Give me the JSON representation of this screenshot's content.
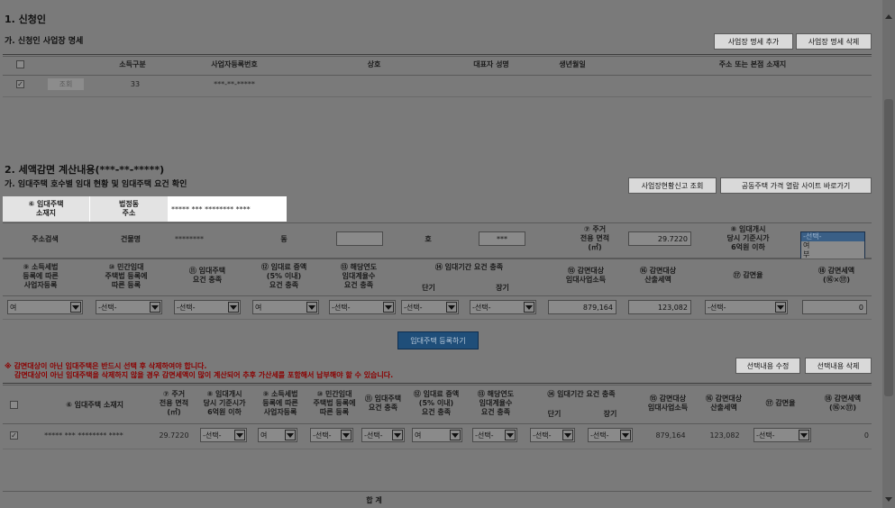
{
  "section1": {
    "title": "1. 신청인",
    "subtitle": "가. 신청인 사업장 명세",
    "add_btn": "사업장 명세 추가",
    "del_btn": "사업장 명세 삭제",
    "headers": [
      "소득구분",
      "사업자등록번호",
      "상호",
      "대표자 성명",
      "생년월일",
      "주소 또는 본점 소재지"
    ],
    "row": {
      "lookup_btn": "조회",
      "income_type": "33",
      "biz_no": "***-**-*****"
    }
  },
  "section2": {
    "title": "2. 세액감면 계산내용(***-**-*****)",
    "subtitle": "가. 임대주택 호수별 임대 현황 및 임대주택 요건 확인",
    "biz_status_btn": "사업장현황신고 조회",
    "price_site_btn": "공동주택 가격 열람 사이트 바로가기",
    "location": {
      "label1": "⑥ 임대주택",
      "label2": "소재지",
      "legal_dong_1": "법정동",
      "legal_dong_2": "주소",
      "value": "*****  ***  ********  ****"
    },
    "addr_row": {
      "search": "주소검색",
      "building": "건물명",
      "building_val": "********",
      "dong": "동",
      "ho": "호",
      "ho_val": "***",
      "area_l1": "⑦ 주거",
      "area_l2": "전용 면적",
      "area_l3": "(㎡)",
      "area_val": "29.7220",
      "price_l1": "⑧ 임대개시",
      "price_l2": "당시 기준시가",
      "price_l3": "6억원 이하",
      "dropdown_options": [
        "-선택-",
        "여",
        "부"
      ]
    },
    "req_headers": {
      "h1": [
        "⑨ 소득세법",
        "등록에 따른",
        "사업자등록"
      ],
      "h2": [
        "⑩ 민간임대",
        "주택법 등록에",
        "따른 등록"
      ],
      "h3": [
        "⑪ 임대주택",
        "요건 충족"
      ],
      "h4": [
        "⑫ 임대료 증액",
        "(5% 이내)",
        "요건 충족"
      ],
      "h5": [
        "⑬ 해당연도",
        "임대계율수",
        "요건 충족"
      ],
      "h6": "⑭ 임대기간 요건 충족",
      "h6a": "단기",
      "h6b": "장기",
      "h7": [
        "⑮ 감면대상",
        "임대사업소득"
      ],
      "h8": [
        "⑯ 감면대상",
        "산출세액"
      ],
      "h9": "⑰ 감면율",
      "h10": [
        "⑱ 감면세액",
        "(⑯×⑰)"
      ]
    },
    "req_values": {
      "v1": "여",
      "v2": "-선택-",
      "v3": "-선택-",
      "v4": "여",
      "v5": "-선택-",
      "v6a": "-선택-",
      "v6b": "-선택-",
      "income": "879,164",
      "tax": "123,082",
      "rate": "-선택-",
      "exempt": "0"
    },
    "register_btn": "임대주택 등록하기",
    "warn1": "※ 감면대상이 아닌 임대주택은 반드시 선택 후 삭제하여야 합니다.",
    "warn2": "감면대상이 아닌 임대주택을 삭제하지 않을 경우 감면세액이 많이 계산되어 추후 가산세를 포함해서 납부해야 할 수 있습니다.",
    "edit_btn": "선택내용 수정",
    "delete_btn": "선택내용 삭제"
  },
  "list": {
    "headers": {
      "loc": "⑥ 임대주택 소재지",
      "area": [
        "⑦ 주거",
        "전용 면적",
        "(㎡)"
      ],
      "price": [
        "⑧ 임대개시",
        "당시 기준시가",
        "6억원 이하"
      ],
      "h9": [
        "⑨ 소득세법",
        "등록에 따른",
        "사업자등록"
      ],
      "h10": [
        "⑩ 민간임대",
        "주택법 등록에",
        "따른 등록"
      ],
      "h11": [
        "⑪ 임대주택",
        "요건 충족"
      ],
      "h12": [
        "⑫ 임대료 증액",
        "(5% 이내)",
        "요건 충족"
      ],
      "h13": [
        "⑬ 해당연도",
        "임대계율수",
        "요건 충족"
      ],
      "h14": "⑭ 임대기간 요건 충족",
      "h14a": "단기",
      "h14b": "장기",
      "h15": [
        "⑮ 감면대상",
        "임대사업소득"
      ],
      "h16": [
        "⑯ 감면대상",
        "산출세액"
      ],
      "h17": "⑰ 감면율",
      "h18": [
        "⑱ 감면세액",
        "(⑯×⑰)"
      ]
    },
    "row": {
      "loc": "*****  ***  ********  ****",
      "area": "29.7220",
      "price": "-선택-",
      "h9": "여",
      "h10": "-선택-",
      "h11": "-선택-",
      "h12": "여",
      "h13": "-선택-",
      "h14a": "-선택-",
      "h14b": "-선택-",
      "income": "879,164",
      "tax": "123,082",
      "rate": "-선택-",
      "exempt": "0"
    },
    "total": "합   계"
  }
}
